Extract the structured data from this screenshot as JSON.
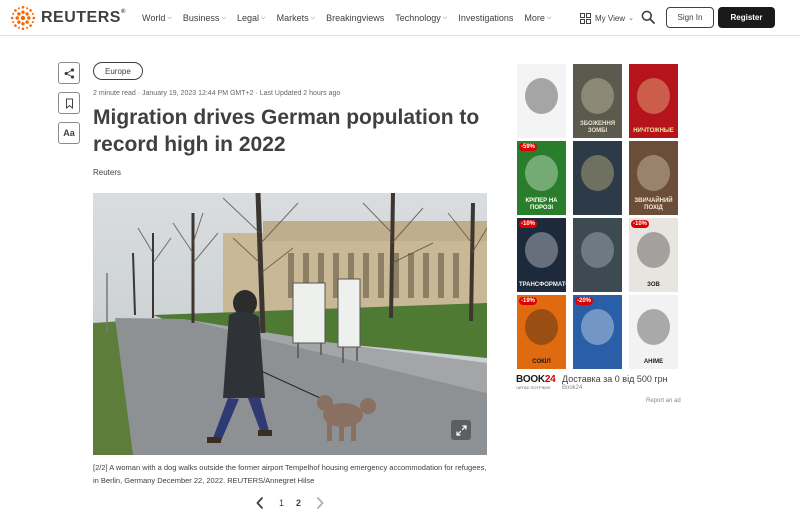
{
  "header": {
    "logo_text": "REUTERS",
    "logo_reg": "®",
    "nav": [
      {
        "label": "World",
        "chevron": true
      },
      {
        "label": "Business",
        "chevron": true
      },
      {
        "label": "Legal",
        "chevron": true
      },
      {
        "label": "Markets",
        "chevron": true
      },
      {
        "label": "Breakingviews",
        "chevron": false
      },
      {
        "label": "Technology",
        "chevron": true
      },
      {
        "label": "Investigations",
        "chevron": false
      },
      {
        "label": "More",
        "chevron": true
      }
    ],
    "my_view_label": "My View",
    "sign_in_label": "Sign In",
    "register_label": "Register"
  },
  "tools": {
    "font_size_label": "Aa"
  },
  "article": {
    "section_tag": "Europe",
    "meta": "2 minute read · January 19, 2023 12:44 PM GMT+2 · Last Updated 2 hours ago",
    "headline": "Migration drives German population to record high in 2022",
    "byline": "Reuters",
    "caption_index": "[2/2]",
    "caption_text": " A woman with a dog walks outside the former airport Tempelhof housing emergency accommodation for refugees, in Berlin, Germany December 22, 2022. REUTERS/Annegret Hilse",
    "pager": {
      "pages": [
        "1",
        "2"
      ],
      "current": "2"
    }
  },
  "ad": {
    "books": [
      {
        "title": "",
        "badge": "",
        "bg": "#f4f4f4",
        "fg": "#111"
      },
      {
        "title": "ЗБОЖЕННЯ ЗОМБІ",
        "badge": "",
        "bg": "#5a5a4e",
        "fg": "#e8e0c8"
      },
      {
        "title": "НИЧТОЖНЫЕ",
        "badge": "",
        "bg": "#b5141c",
        "fg": "#f4e4a0"
      },
      {
        "title": "КРІПЕР НА ПОРОЗІ",
        "badge": "-59%",
        "bg": "#2a7d2a",
        "fg": "#fff"
      },
      {
        "title": "",
        "badge": "",
        "bg": "#2d3a48",
        "fg": "#e8d890"
      },
      {
        "title": "ЗВИЧАЙНИЙ ПОХІД",
        "badge": "",
        "bg": "#6b4e3a",
        "fg": "#f4e8d0"
      },
      {
        "title": "ТРАНСФОРМАТОР",
        "badge": "-10%",
        "bg": "#1d2a3c",
        "fg": "#f0f0f0"
      },
      {
        "title": "",
        "badge": "",
        "bg": "#3e4a52",
        "fg": "#c8d4dc"
      },
      {
        "title": "ЗОВ",
        "badge": "-10%",
        "bg": "#e8e4e0",
        "fg": "#222"
      },
      {
        "title": "СОКІЛ",
        "badge": "-19%",
        "bg": "#e06a10",
        "fg": "#1a1a1a"
      },
      {
        "title": "",
        "badge": "-20%",
        "bg": "#2a5fa8",
        "fg": "#fff"
      },
      {
        "title": "АНІМЕ",
        "badge": "",
        "bg": "#f2f2f2",
        "fg": "#222"
      }
    ],
    "brand_a": "BOOK",
    "brand_b": "24",
    "brand_sub": "ЧИТАЄ ПОТРІБНЕ",
    "offer": "Доставка за 0 від 500 грн",
    "source": "Book24",
    "report_label": "Report an ad"
  }
}
